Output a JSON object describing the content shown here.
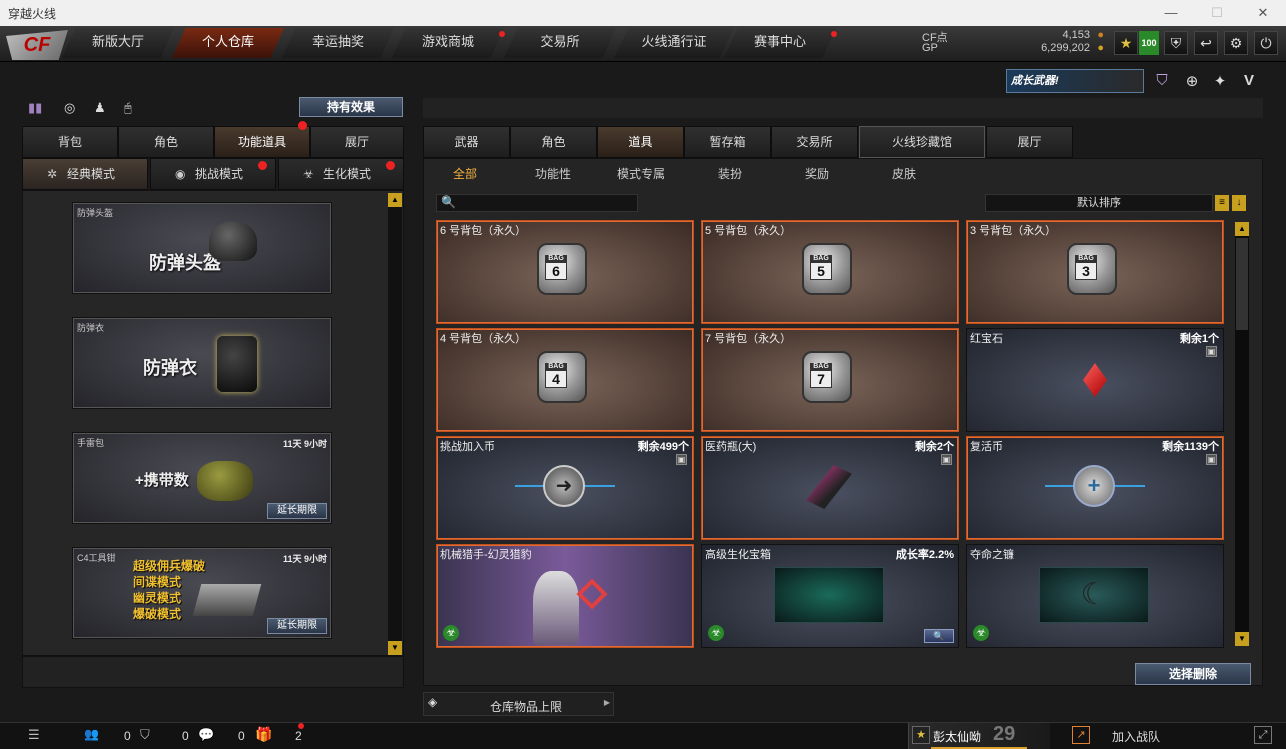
{
  "window": {
    "title": "穿越火线"
  },
  "nav": {
    "tabs": [
      "新版大厅",
      "个人仓库",
      "幸运抽奖",
      "游戏商城",
      "交易所",
      "火线通行证",
      "赛事中心"
    ],
    "active": 1
  },
  "currency": {
    "cf_label": "CF点",
    "cf_value": "4,153",
    "gp_label": "GP",
    "gp_value": "6,299,202",
    "level_badge": "100"
  },
  "promo": {
    "text": "成长武器!"
  },
  "left": {
    "effects_button": "持有效果",
    "tabs": [
      "背包",
      "角色",
      "功能道具",
      "展厅"
    ],
    "modes": [
      "经典模式",
      "挑战模式",
      "生化模式"
    ],
    "cards": [
      {
        "name": "防弹头盔",
        "big": "防弹头盔",
        "time": ""
      },
      {
        "name": "防弹衣",
        "big": "防弹衣",
        "time": ""
      },
      {
        "name": "手雷包",
        "big": "+携带数",
        "time": "11天 9小时",
        "button": "延长期限"
      },
      {
        "name": "C4工具钳",
        "big_lines": [
          "超级佣兵爆破",
          "间谍模式",
          "幽灵模式",
          "爆破模式"
        ],
        "time": "11天 9小时",
        "button": "延长期限"
      }
    ]
  },
  "main": {
    "tabs": [
      "武器",
      "角色",
      "道具",
      "暂存箱",
      "交易所",
      "火线珍藏馆",
      "展厅"
    ],
    "subtabs": [
      "全部",
      "功能性",
      "模式专属",
      "装扮",
      "奖励",
      "皮肤"
    ],
    "sort_label": "默认排序",
    "items": [
      {
        "name": "6 号背包（永久）",
        "bag": "6",
        "style": "brown"
      },
      {
        "name": "5 号背包（永久）",
        "bag": "5",
        "style": "brown"
      },
      {
        "name": "3 号背包（永久）",
        "bag": "3",
        "style": "brown"
      },
      {
        "name": "4 号背包（永久）",
        "bag": "4",
        "style": "brown"
      },
      {
        "name": "7 号背包（永久）",
        "bag": "7",
        "style": "brown"
      },
      {
        "name": "红宝石",
        "remain": "剩余1个",
        "style": "blue"
      },
      {
        "name": "挑战加入币",
        "remain": "剩余499个",
        "style": "blue"
      },
      {
        "name": "医药瓶(大)",
        "remain": "剩余2个",
        "style": "blue"
      },
      {
        "name": "复活币",
        "remain": "剩余1139个",
        "style": "blue"
      },
      {
        "name": "机械猎手-幻灵猎豹",
        "remain": "",
        "style": "purple"
      },
      {
        "name": "高级生化宝箱",
        "remain": "成长率2.2%",
        "style": "blue"
      },
      {
        "name": "夺命之镰",
        "remain": "",
        "style": "blue"
      }
    ],
    "bag_label": "BAG",
    "delete_button": "选择删除",
    "capacity_label": "仓库物品上限"
  },
  "status": {
    "count1": "0",
    "count2": "0",
    "count3": "0",
    "gift_count": "2",
    "player_name": "彭太仙呦",
    "level": "29",
    "join_battle": "加入战队"
  }
}
